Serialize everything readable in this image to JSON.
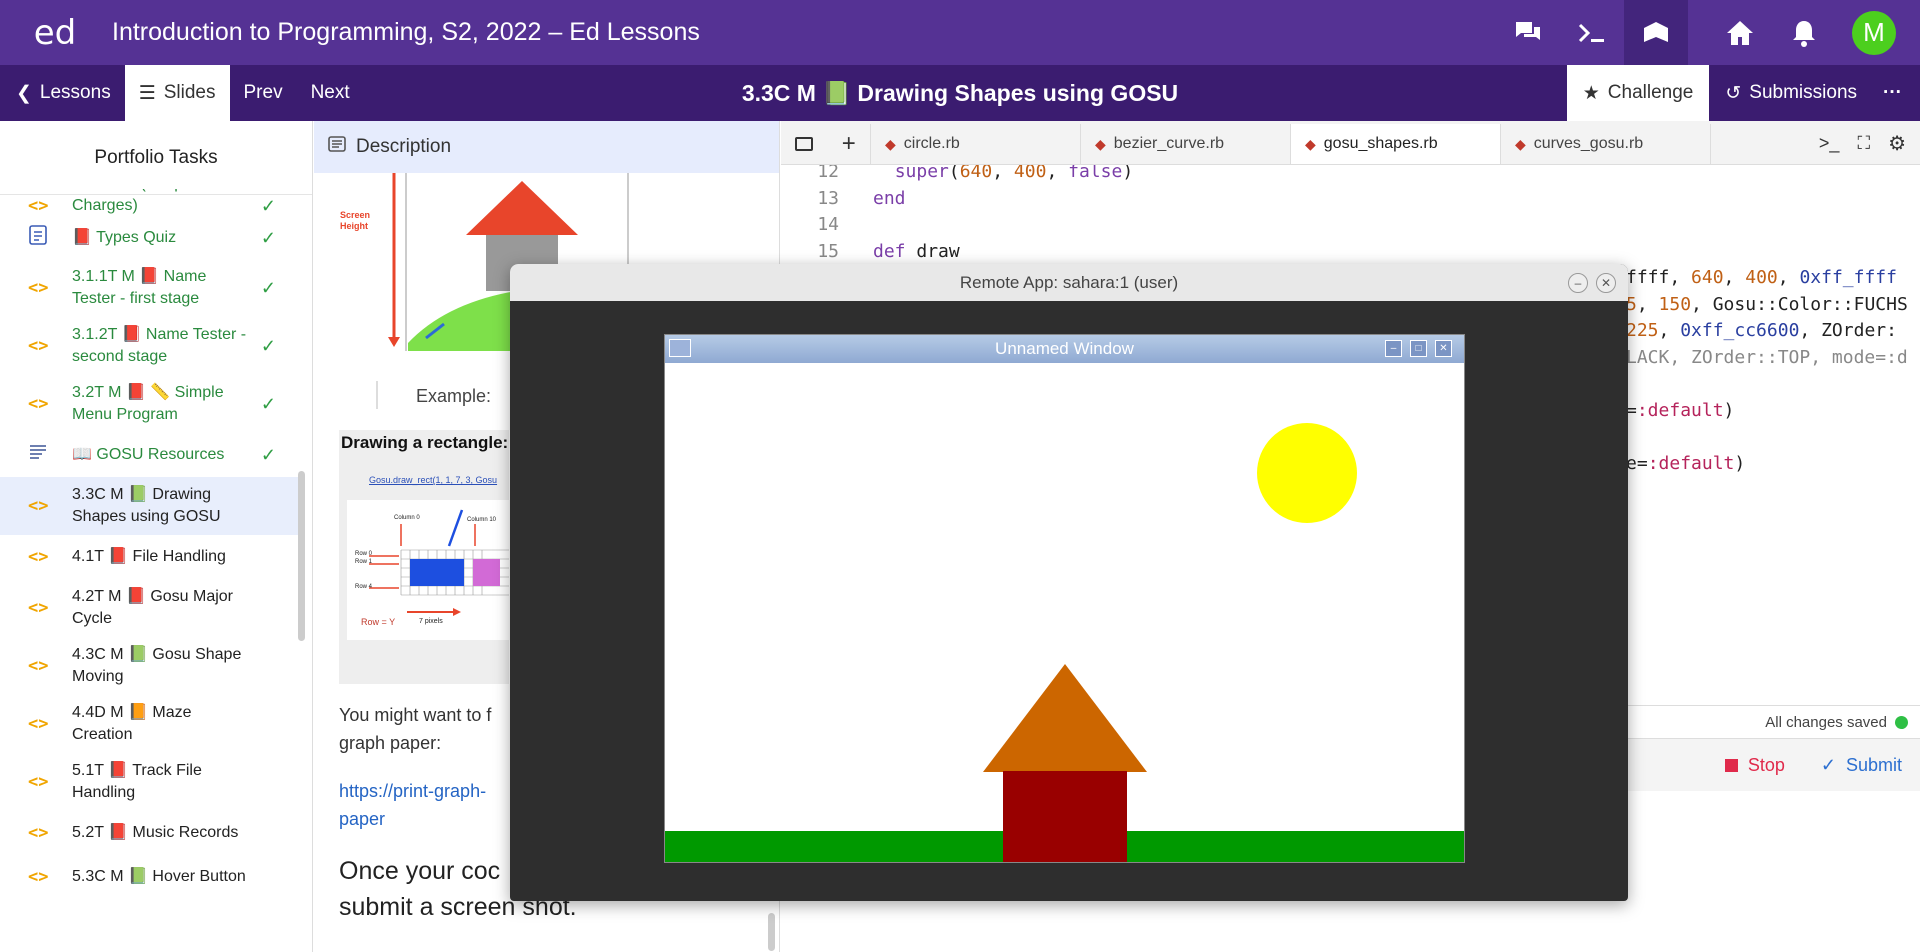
{
  "app": {
    "logo": "ed",
    "title": "Introduction to Programming, S2, 2022 – Ed Lessons",
    "avatar": "M"
  },
  "topicons": [
    "discussion-icon",
    "terminal-icon",
    "lessons-icon",
    "home-icon",
    "bell-icon"
  ],
  "subbar": {
    "lessons": "Lessons",
    "slides": "Slides",
    "prev": "Prev",
    "next": "Next",
    "lesson_title": "3.3C M 📗 Drawing Shapes using GOSU",
    "challenge": "Challenge",
    "submissions": "Submissions",
    "more": "···"
  },
  "sidebar": {
    "heading": "Portfolio Tasks",
    "partial": "functions (Hospital Charges)",
    "items": [
      {
        "label": "📕 Types Quiz",
        "icon": "quiz-icon",
        "done": true
      },
      {
        "label": "3.1.1T M 📕 Name Tester - first stage",
        "icon": "code-icon",
        "done": true
      },
      {
        "label": "3.1.2T 📕 Name Tester - second stage",
        "icon": "code-icon",
        "done": true
      },
      {
        "label": "3.2T M 📕 📏 Simple Menu Program",
        "icon": "code-icon",
        "done": true
      },
      {
        "label": "📖 GOSU Resources",
        "icon": "document-icon",
        "done": true
      },
      {
        "label": "3.3C M 📗 Drawing Shapes using GOSU",
        "icon": "code-icon",
        "done": false,
        "active": true
      },
      {
        "label": "4.1T 📕 File Handling",
        "icon": "code-icon",
        "done": false
      },
      {
        "label": "4.2T M 📕 Gosu Major Cycle",
        "icon": "code-icon",
        "done": false
      },
      {
        "label": "4.3C M 📗 Gosu Shape Moving",
        "icon": "code-icon",
        "done": false
      },
      {
        "label": "4.4D M 📙 Maze Creation",
        "icon": "code-icon",
        "done": false
      },
      {
        "label": "5.1T 📕 Track File Handling",
        "icon": "code-icon",
        "done": false
      },
      {
        "label": "5.2T 📕 Music Records",
        "icon": "code-icon",
        "done": false
      },
      {
        "label": "5.3C M 📗 Hover Button",
        "icon": "code-icon",
        "done": false
      }
    ]
  },
  "description": {
    "heading": "Description",
    "figure_screen_height": "Screen Height",
    "example_label": "Example:",
    "rect_caption": "Drawing a rectangle:",
    "rect_code": "Gosu.draw_rect(1, 1, 7, 3, Gosu",
    "col0": "Column 0",
    "col10": "Column 10",
    "row0": "Row 0",
    "row1": "Row 1",
    "row4": "Row 4",
    "rowy": "Row = Y",
    "pixels": "7 pixels",
    "para1": "You might want to f",
    "para1b": "graph paper:",
    "link1": "https://print-graph-",
    "link2": "paper",
    "para2a": "Once your coc",
    "para2b": "submit a screen shot."
  },
  "editor": {
    "tabs": [
      "circle.rb",
      "bezier_curve.rb",
      "gosu_shapes.rb",
      "curves_gosu.rb"
    ],
    "active_tab": 2,
    "lines": [
      {
        "n": "12",
        "t": "  super(640, 400, false)"
      },
      {
        "n": "13",
        "t": "end"
      },
      {
        "n": "14",
        "t": ""
      },
      {
        "n": "15",
        "t": "def draw"
      }
    ],
    "right_fragments": [
      "ffff, 640, 400, 0xff_ffff",
      "5, 150, Gosu::Color::FUCHS",
      "225, 0xff_cc6600, ZOrder:",
      "LACK, ZOrder::TOP, mode=:d",
      "",
      "=:default)",
      "",
      "e=:default)"
    ],
    "status": "All changes saved",
    "stop": "Stop",
    "submit": "Submit"
  },
  "remote": {
    "title": "Remote App: sahara:1 (user)",
    "inner_title": "Unnamed Window"
  },
  "colors": {
    "sun": "#ffff00",
    "roof": "#cc6600",
    "house": "#990000",
    "grass": "#009900",
    "topbar": "#553294"
  }
}
